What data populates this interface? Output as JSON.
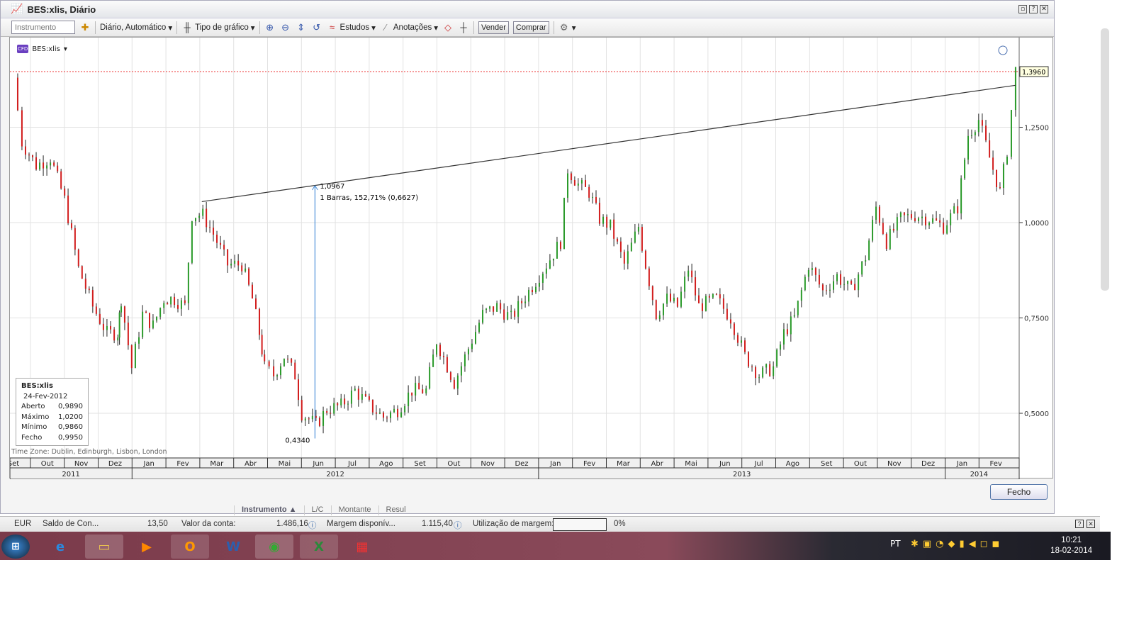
{
  "window": {
    "title": "BES:xlis, Diário"
  },
  "toolbar": {
    "instrument_placeholder": "Instrumento",
    "period": "Diário, Automático",
    "chart_type": "Tipo de gráfico",
    "studies": "Estudos",
    "annotations": "Anotações",
    "sell": "Vender",
    "buy": "Comprar"
  },
  "chart": {
    "symbol": "BES:xlis",
    "timezone": "Time Zone: Dublin, Edinburgh, Lisbon, London",
    "last_price_label": "1,3960",
    "annotation": {
      "high": "1,0967",
      "bars": "1 Barras, 152,71% (0,6627)",
      "low": "0,4340"
    },
    "info": {
      "symbol": "BES:xlis",
      "date": "24-Fev-2012",
      "rows": [
        {
          "k": "Aberto",
          "v": "0,9890"
        },
        {
          "k": "Máximo",
          "v": "1,0200"
        },
        {
          "k": "Mínimo",
          "v": "0,9860"
        },
        {
          "k": "Fecho",
          "v": "0,9950"
        }
      ]
    }
  },
  "chart_data": {
    "type": "candlestick",
    "title": "BES:xlis, Diário",
    "ylim": [
      0.3,
      1.5
    ],
    "yticks": [
      {
        "v": 1.25,
        "label": "1,2500"
      },
      {
        "v": 1.0,
        "label": "1,0000"
      },
      {
        "v": 0.75,
        "label": "0,7500"
      },
      {
        "v": 0.5,
        "label": "0,5000"
      }
    ],
    "months": [
      "Set",
      "Out",
      "Nov",
      "Dez",
      "Jan",
      "Fev",
      "Mar",
      "Abr",
      "Mai",
      "Jun",
      "Jul",
      "Ago",
      "Set",
      "Out",
      "Nov",
      "Dez",
      "Jan",
      "Fev",
      "Mar",
      "Abr",
      "Mai",
      "Jun",
      "Jul",
      "Ago",
      "Set",
      "Out",
      "Nov",
      "Dez",
      "Jan",
      "Fev"
    ],
    "years": [
      {
        "label": "2011",
        "from": 0,
        "to": 4
      },
      {
        "label": "2012",
        "from": 4,
        "to": 16
      },
      {
        "label": "2013",
        "from": 16,
        "to": 28
      },
      {
        "label": "2014",
        "from": 28,
        "to": 30
      }
    ],
    "close_path": [
      [
        0,
        1.38
      ],
      [
        0.25,
        1.21
      ],
      [
        0.67,
        1.15
      ],
      [
        1.09,
        1.17
      ],
      [
        1.51,
        1.06
      ],
      [
        1.92,
        0.88
      ],
      [
        2.34,
        0.78
      ],
      [
        2.76,
        0.71
      ],
      [
        3.08,
        0.71
      ],
      [
        3.18,
        0.8
      ],
      [
        3.49,
        0.62
      ],
      [
        3.81,
        0.76
      ],
      [
        4.12,
        0.73
      ],
      [
        4.44,
        0.8
      ],
      [
        4.75,
        0.8
      ],
      [
        5.06,
        0.78
      ],
      [
        5.27,
        1.02
      ],
      [
        5.59,
        1.02
      ],
      [
        5.9,
        0.97
      ],
      [
        6.32,
        0.89
      ],
      [
        6.74,
        0.89
      ],
      [
        7.05,
        0.8
      ],
      [
        7.26,
        0.71
      ],
      [
        7.41,
        0.62
      ],
      [
        7.68,
        0.6
      ],
      [
        7.99,
        0.65
      ],
      [
        8.31,
        0.6
      ],
      [
        8.51,
        0.5
      ],
      [
        8.93,
        0.47
      ],
      [
        9.25,
        0.51
      ],
      [
        9.67,
        0.52
      ],
      [
        10.08,
        0.56
      ],
      [
        10.5,
        0.52
      ],
      [
        10.92,
        0.49
      ],
      [
        11.34,
        0.51
      ],
      [
        11.76,
        0.56
      ],
      [
        12.18,
        0.56
      ],
      [
        12.49,
        0.69
      ],
      [
        13.01,
        0.58
      ],
      [
        13.43,
        0.67
      ],
      [
        13.85,
        0.76
      ],
      [
        14.27,
        0.78
      ],
      [
        14.69,
        0.75
      ],
      [
        15.21,
        0.82
      ],
      [
        15.73,
        0.89
      ],
      [
        16.15,
        0.95
      ],
      [
        16.36,
        1.14
      ],
      [
        16.67,
        1.1
      ],
      [
        16.99,
        1.08
      ],
      [
        17.3,
        1.01
      ],
      [
        17.62,
        0.99
      ],
      [
        18.03,
        0.89
      ],
      [
        18.45,
        0.99
      ],
      [
        18.66,
        0.89
      ],
      [
        18.97,
        0.76
      ],
      [
        19.29,
        0.8
      ],
      [
        19.6,
        0.78
      ],
      [
        19.92,
        0.88
      ],
      [
        20.23,
        0.78
      ],
      [
        20.75,
        0.8
      ],
      [
        21.17,
        0.75
      ],
      [
        21.59,
        0.65
      ],
      [
        22.01,
        0.6
      ],
      [
        22.43,
        0.62
      ],
      [
        22.74,
        0.71
      ],
      [
        23.05,
        0.75
      ],
      [
        23.47,
        0.89
      ],
      [
        23.89,
        0.82
      ],
      [
        24.31,
        0.86
      ],
      [
        24.73,
        0.82
      ],
      [
        25.15,
        0.91
      ],
      [
        25.46,
        1.04
      ],
      [
        25.77,
        0.95
      ],
      [
        26.19,
        1.01
      ],
      [
        26.61,
        1.02
      ],
      [
        27.03,
        1.01
      ],
      [
        27.45,
        0.99
      ],
      [
        27.87,
        1.04
      ],
      [
        28.18,
        1.23
      ],
      [
        28.49,
        1.27
      ],
      [
        28.81,
        1.17
      ],
      [
        29.12,
        1.08
      ],
      [
        29.33,
        1.19
      ],
      [
        29.58,
        1.4
      ]
    ],
    "trendline": [
      [
        5.56,
        1.055
      ],
      [
        29.58,
        1.36
      ]
    ],
    "measure": {
      "t": 8.9,
      "from": 0.434,
      "to": 1.0967
    },
    "last_price": 1.396
  },
  "bottom": {
    "close_button": "Fecho",
    "tabs": [
      "Instrumento ▲",
      "L/C",
      "Montante",
      "Resul"
    ]
  },
  "status": {
    "currency": "EUR",
    "balance_label": "Saldo de Con...",
    "balance": "13,50",
    "account_label": "Valor da conta:",
    "account": "1.486,16",
    "margin_label": "Margem disponív...",
    "margin": "1.115,40",
    "util_label": "Utilização de margem:",
    "util": "0%"
  },
  "taskbar": {
    "lang": "PT",
    "time": "10:21",
    "date": "18-02-2014"
  }
}
